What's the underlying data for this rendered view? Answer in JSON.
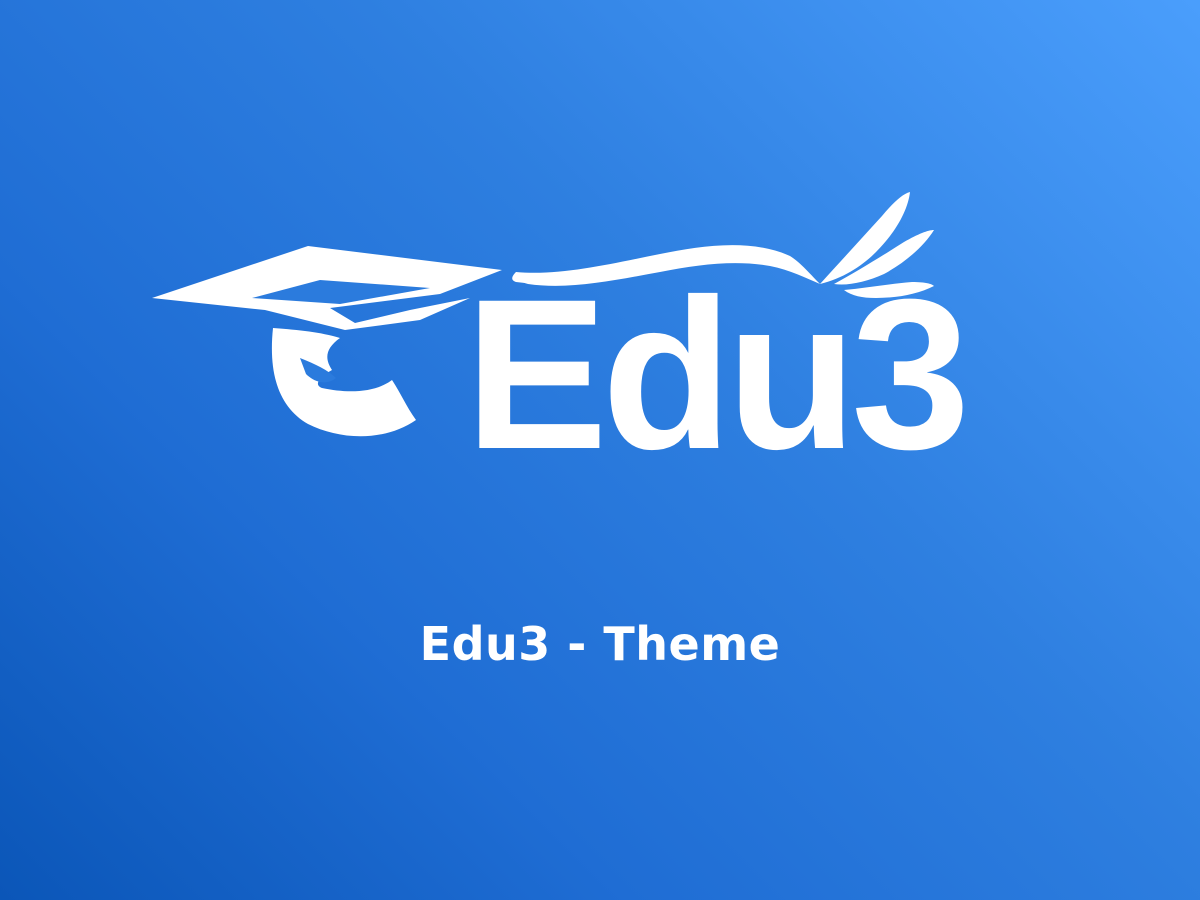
{
  "brand": {
    "logo_text": "Edu3",
    "logo_icon": "graduation-cap-icon",
    "background_colors": [
      "#4A9EFC",
      "#2E7FE0",
      "#0B56B8"
    ],
    "foreground_color": "#FFFFFF"
  },
  "subtitle": "Edu3 - Theme"
}
